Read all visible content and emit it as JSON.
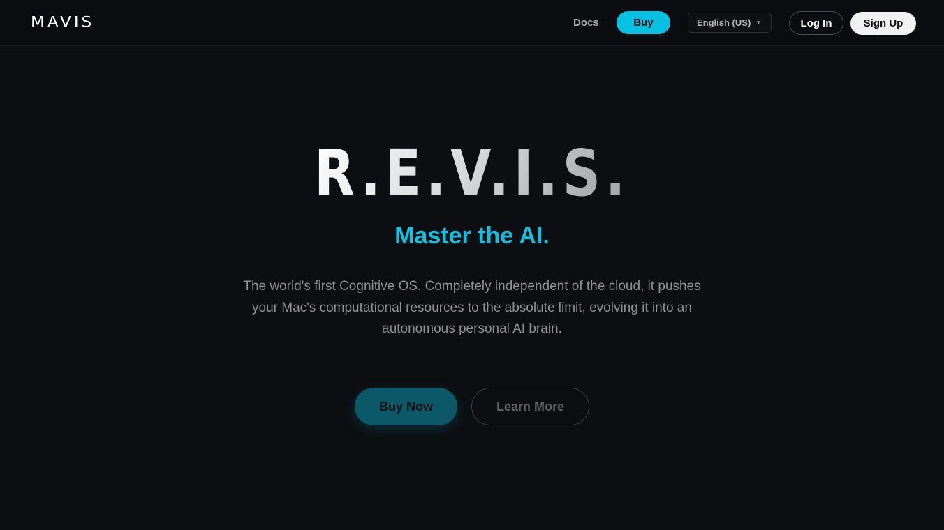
{
  "header": {
    "logo": "MAVIS",
    "nav": {
      "docs_label": "Docs",
      "buy_label": "Buy"
    },
    "language": {
      "selected": "English (US)",
      "caret_icon": "caret-down-icon"
    },
    "auth": {
      "login_label": "Log In",
      "signup_label": "Sign Up"
    }
  },
  "hero": {
    "title": "R.E.V.I.S.",
    "tagline": "Master the AI.",
    "description": "The world's first Cognitive OS. Completely independent of the cloud, it pushes your Mac's computational resources to the absolute limit, evolving it into an autonomous personal AI brain.",
    "primary_cta": "Buy Now",
    "secondary_cta": "Learn More"
  },
  "colors": {
    "background": "#0d0e11",
    "accent": "#08c0e2",
    "tagline": "#15bfe0",
    "primary_cta_bg": "#0b5869"
  }
}
